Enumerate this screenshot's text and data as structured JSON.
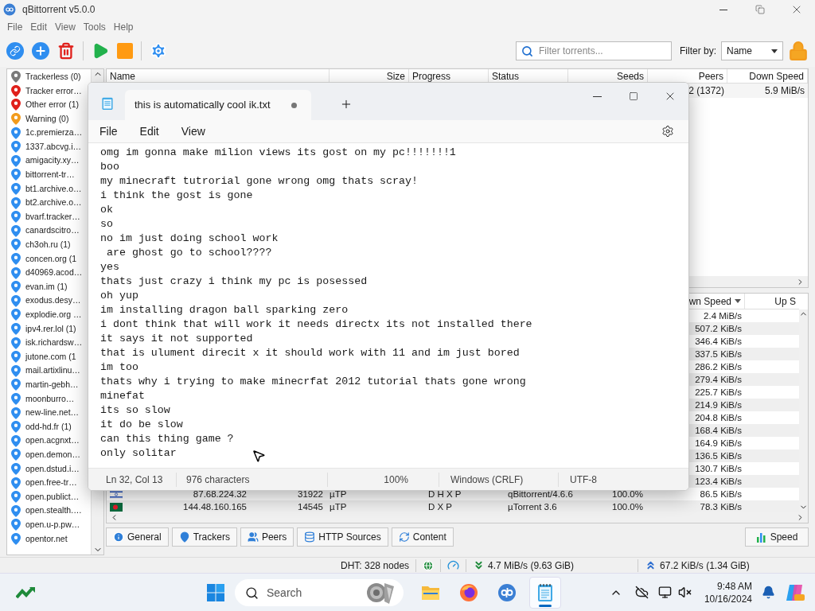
{
  "window": {
    "title": "qBittorrent v5.0.0"
  },
  "menu": [
    "File",
    "Edit",
    "View",
    "Tools",
    "Help"
  ],
  "filter": {
    "placeholder": "Filter torrents...",
    "label": "Filter by:",
    "value": "Name"
  },
  "sidebar": {
    "items": [
      {
        "label": "Trackerless (0)",
        "color": "#7a7a7a"
      },
      {
        "label": "Tracker error…",
        "color": "#e0201b"
      },
      {
        "label": "Other error (1)",
        "color": "#e0201b"
      },
      {
        "label": "Warning (0)",
        "color": "#f29b1d"
      },
      {
        "label": "1c.premierza…",
        "color": "#2f8ef0"
      },
      {
        "label": "1337.abcvg.i…",
        "color": "#2f8ef0"
      },
      {
        "label": "amigacity.xy…",
        "color": "#2f8ef0"
      },
      {
        "label": "bittorrent-tr…",
        "color": "#2f8ef0"
      },
      {
        "label": "bt1.archive.o…",
        "color": "#2f8ef0"
      },
      {
        "label": "bt2.archive.o…",
        "color": "#2f8ef0"
      },
      {
        "label": "bvarf.tracker…",
        "color": "#2f8ef0"
      },
      {
        "label": "canardscitro…",
        "color": "#2f8ef0"
      },
      {
        "label": "ch3oh.ru (1)",
        "color": "#2f8ef0"
      },
      {
        "label": "concen.org (1",
        "color": "#2f8ef0"
      },
      {
        "label": "d40969.acod…",
        "color": "#2f8ef0"
      },
      {
        "label": "evan.im (1)",
        "color": "#2f8ef0"
      },
      {
        "label": "exodus.desy…",
        "color": "#2f8ef0"
      },
      {
        "label": "explodie.org …",
        "color": "#2f8ef0"
      },
      {
        "label": "ipv4.rer.lol (1)",
        "color": "#2f8ef0"
      },
      {
        "label": "isk.richardsw…",
        "color": "#2f8ef0"
      },
      {
        "label": "jutone.com (1",
        "color": "#2f8ef0"
      },
      {
        "label": "mail.artixlinu…",
        "color": "#2f8ef0"
      },
      {
        "label": "martin-gebh…",
        "color": "#2f8ef0"
      },
      {
        "label": "moonburro…",
        "color": "#2f8ef0"
      },
      {
        "label": "new-line.net…",
        "color": "#2f8ef0"
      },
      {
        "label": "odd-hd.fr (1)",
        "color": "#2f8ef0"
      },
      {
        "label": "open.acgnxt…",
        "color": "#2f8ef0"
      },
      {
        "label": "open.demon…",
        "color": "#2f8ef0"
      },
      {
        "label": "open.dstud.i…",
        "color": "#2f8ef0"
      },
      {
        "label": "open.free-tr…",
        "color": "#2f8ef0"
      },
      {
        "label": "open.publict…",
        "color": "#2f8ef0"
      },
      {
        "label": "open.stealth.…",
        "color": "#2f8ef0"
      },
      {
        "label": "open.u-p.pw…",
        "color": "#2f8ef0"
      },
      {
        "label": "opentor.net",
        "color": "#2f8ef0"
      }
    ]
  },
  "torrents": {
    "columns": [
      "Name",
      "Size",
      "Progress",
      "Status",
      "Seeds",
      "Peers",
      "Down Speed"
    ],
    "rows": [
      {
        "peers": "2 (1372)",
        "down_speed": "5.9 MiB/s"
      }
    ]
  },
  "peers": {
    "columns": {
      "down_speed": "wn Speed",
      "up_speed": "Up S"
    },
    "rows": [
      {
        "down_speed": "2.4 MiB/s"
      },
      {
        "down_speed": "507.2 KiB/s"
      },
      {
        "down_speed": "346.4 KiB/s"
      },
      {
        "down_speed": "337.5 KiB/s"
      },
      {
        "down_speed": "286.2 KiB/s"
      },
      {
        "down_speed": "279.4 KiB/s"
      },
      {
        "down_speed": "225.7 KiB/s"
      },
      {
        "down_speed": "214.9 KiB/s"
      },
      {
        "down_speed": "204.8 KiB/s"
      },
      {
        "down_speed": "168.4 KiB/s"
      },
      {
        "down_speed": "164.9 KiB/s"
      },
      {
        "down_speed": "136.5 KiB/s"
      },
      {
        "down_speed": "130.7 KiB/s"
      },
      {
        "down_speed": "123.4 KiB/s"
      },
      {
        "kind": "flag_il",
        "ip": "87.68.224.32",
        "port": "31922",
        "connection": "µTP",
        "flags": "D H X P",
        "client": "qBittorrent/4.6.6",
        "progress": "100.0%",
        "down_speed": "86.5 KiB/s"
      },
      {
        "kind": "flag_bd",
        "ip": "144.48.160.165",
        "port": "14545",
        "connection": "µTP",
        "flags": "D X P",
        "client": "µTorrent 3.6",
        "progress": "100.0%",
        "down_speed": "78.3 KiB/s"
      }
    ]
  },
  "detail_tabs": [
    "General",
    "Trackers",
    "Peers",
    "HTTP Sources",
    "Content"
  ],
  "speed_button": "Speed",
  "status_bar": {
    "dht": "DHT: 328 nodes",
    "download": "4.7 MiB/s (9.63 GiB)",
    "upload": "67.2 KiB/s (1.34 GiB)"
  },
  "notepad": {
    "tab_title": "this is automatically cool ik.txt",
    "unsaved": true,
    "menu": [
      "File",
      "Edit",
      "View"
    ],
    "lines": [
      "omg im gonna make milion views its gost on my pc!!!!!!!1",
      "boo",
      "my minecraft tutrorial gone wrong omg thats scray!",
      "i think the gost is gone",
      "ok",
      "so",
      "no im just doing school work",
      " are ghost go to school????",
      "yes",
      "thats just crazy i think my pc is posessed",
      "oh yup",
      "im installing dragon ball sparking zero",
      "i dont think that will work it needs directx its not installed there",
      "it says it not supported",
      "that is ulument direcit x it should work with 11 and im just bored",
      "im too",
      "thats why i trying to make minecrfat 2012 tutorial thats gone wrong",
      "minefat",
      "its so slow",
      "it do be slow",
      "can this thing game ?",
      "only solitar"
    ],
    "status": [
      "Ln 32, Col 13",
      "976 characters",
      "100%",
      "Windows (CRLF)",
      "UTF-8"
    ]
  },
  "taskbar": {
    "search_placeholder": "Search",
    "time": "9:48 AM",
    "date": "10/16/2024",
    "apps": [
      {
        "kind": "explorer",
        "active": false
      },
      {
        "kind": "firefox",
        "active": false
      },
      {
        "kind": "qbittorrent",
        "active": false
      },
      {
        "kind": "notepad",
        "active": true
      }
    ]
  }
}
